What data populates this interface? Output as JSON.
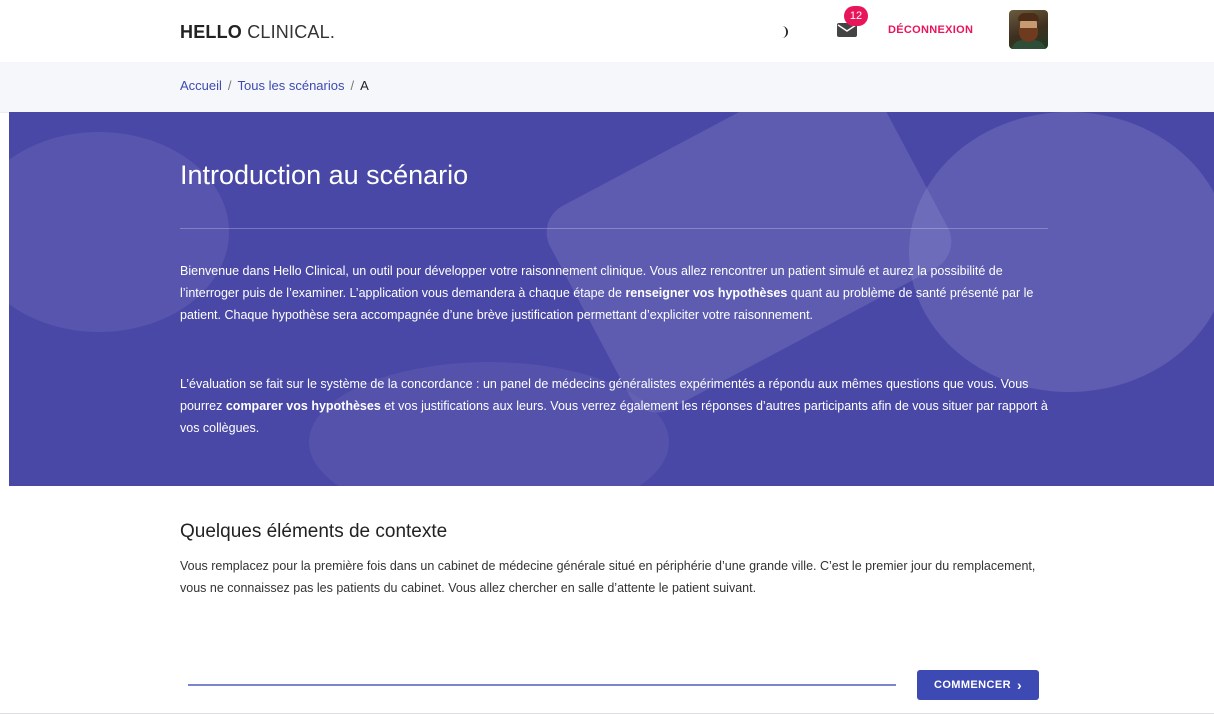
{
  "header": {
    "logo_bold": "HELLO",
    "logo_rest": " CLINICAL.",
    "theme_icon": "moon-icon",
    "mail_icon": "envelope-icon",
    "mail_count": "12",
    "logout_label": "DÉCONNEXION",
    "accent_color": "#e8155b"
  },
  "breadcrumb": {
    "home": "Accueil",
    "separator": "/",
    "all": "Tous les scénarios",
    "current": "A"
  },
  "hero": {
    "title": "Introduction au scénario",
    "p1_a": "Bienvenue dans Hello Clinical, un outil pour développer votre raisonnement clinique. Vous allez rencontrer un patient simulé et aurez la possibilité de l’interroger puis de l’examiner. L’application vous demandera à chaque étape de ",
    "p1_bold": "renseigner vos hypothèses",
    "p1_b": " quant au problème de santé présenté par le patient. Chaque hypothèse sera accompagnée d’une brève justification permettant d’expliciter votre raisonnement.",
    "p2_a": "L’évaluation se fait sur le système de la concordance : un panel de médecins généralistes expérimentés a répondu aux mêmes questions que vous. Vous pourrez ",
    "p2_bold": "comparer vos hypothèses",
    "p2_b": " et vos justifications aux leurs. Vous verrez également les réponses d’autres participants afin de vous situer par rapport à vos collègues.",
    "background_color": "#4a48a6"
  },
  "context": {
    "title": "Quelques éléments de contexte",
    "text": "Vous remplacez pour la première fois dans un cabinet de médecine générale situé en périphérie d’une grande ville. C’est le premier jour du remplacement, vous ne connaissez pas les patients du cabinet. Vous allez chercher en salle d’attente le patient suivant."
  },
  "footer": {
    "start_label": "COMMENCER",
    "start_icon": "chevron-right-icon",
    "button_color": "#3e4ab3"
  }
}
